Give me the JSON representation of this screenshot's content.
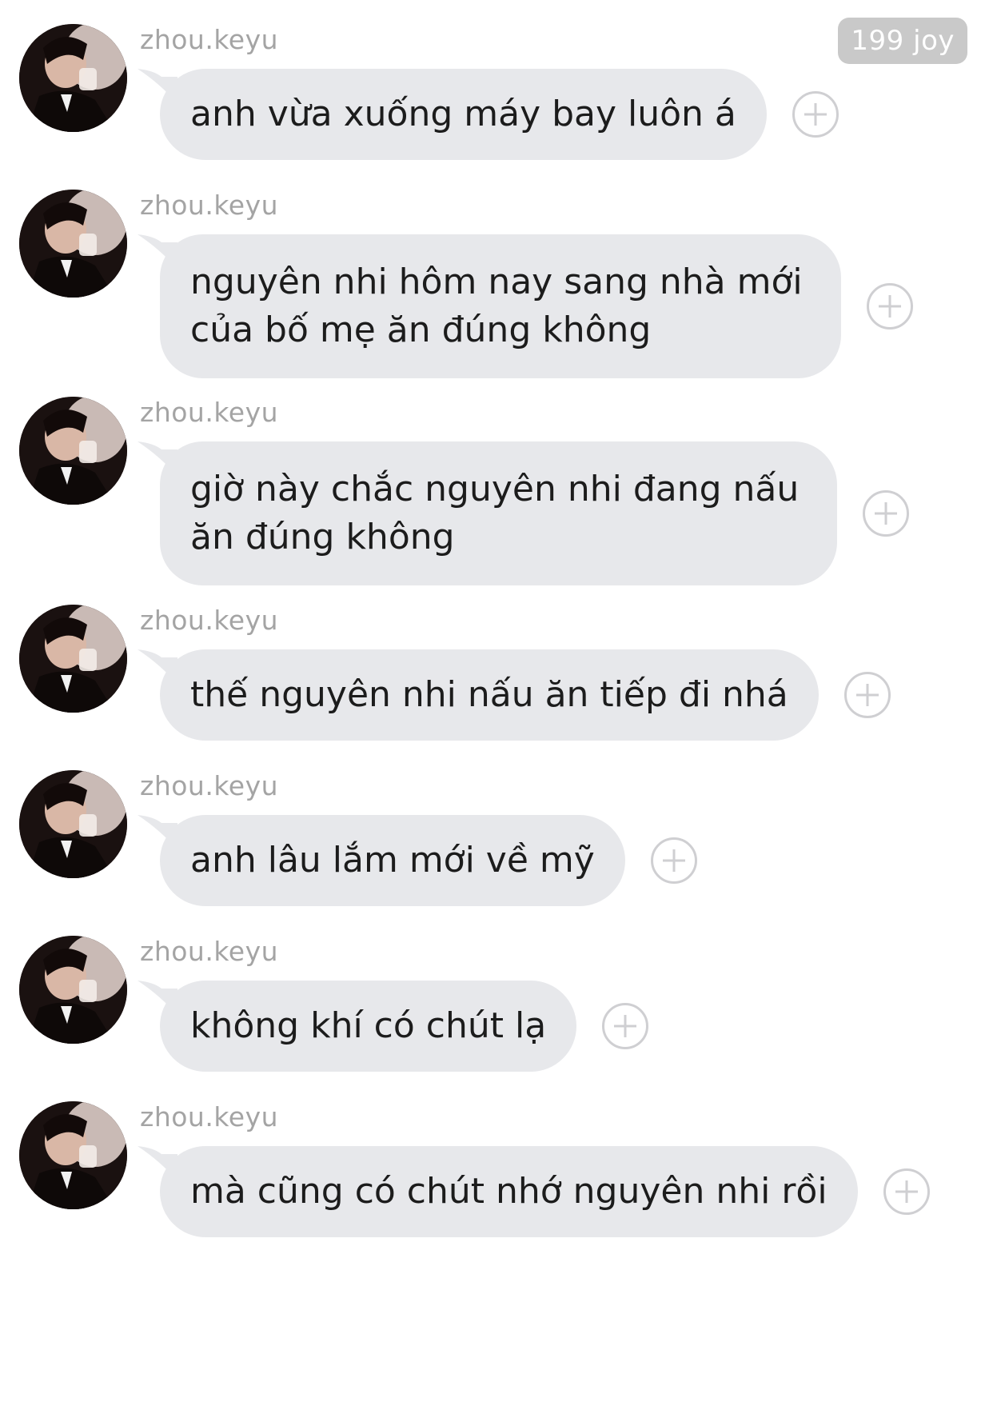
{
  "header": {
    "joy_badge": "199 joy"
  },
  "icons": {
    "add": "plus-circle-icon",
    "avatar": "profile-photo"
  },
  "colors": {
    "bubble": "#e7e8eb",
    "sender_text": "#a4a4a4",
    "badge_bg": "#c9c9c9"
  },
  "messages": [
    {
      "sender": "zhou.keyu",
      "lines": [
        "anh vừa xuống máy bay luôn á"
      ]
    },
    {
      "sender": "zhou.keyu",
      "lines": [
        "nguyên nhi hôm nay sang nhà mới",
        "của bố mẹ ăn đúng không"
      ]
    },
    {
      "sender": "zhou.keyu",
      "lines": [
        "giờ này chắc nguyên nhi đang nấu",
        "ăn đúng không"
      ]
    },
    {
      "sender": "zhou.keyu",
      "lines": [
        "thế nguyên nhi nấu ăn tiếp đi nhá"
      ]
    },
    {
      "sender": "zhou.keyu",
      "lines": [
        "anh lâu lắm mới về mỹ"
      ]
    },
    {
      "sender": "zhou.keyu",
      "lines": [
        "không khí có chút lạ"
      ]
    },
    {
      "sender": "zhou.keyu",
      "lines": [
        "mà cũng có chút nhớ nguyên nhi rồi"
      ]
    }
  ]
}
